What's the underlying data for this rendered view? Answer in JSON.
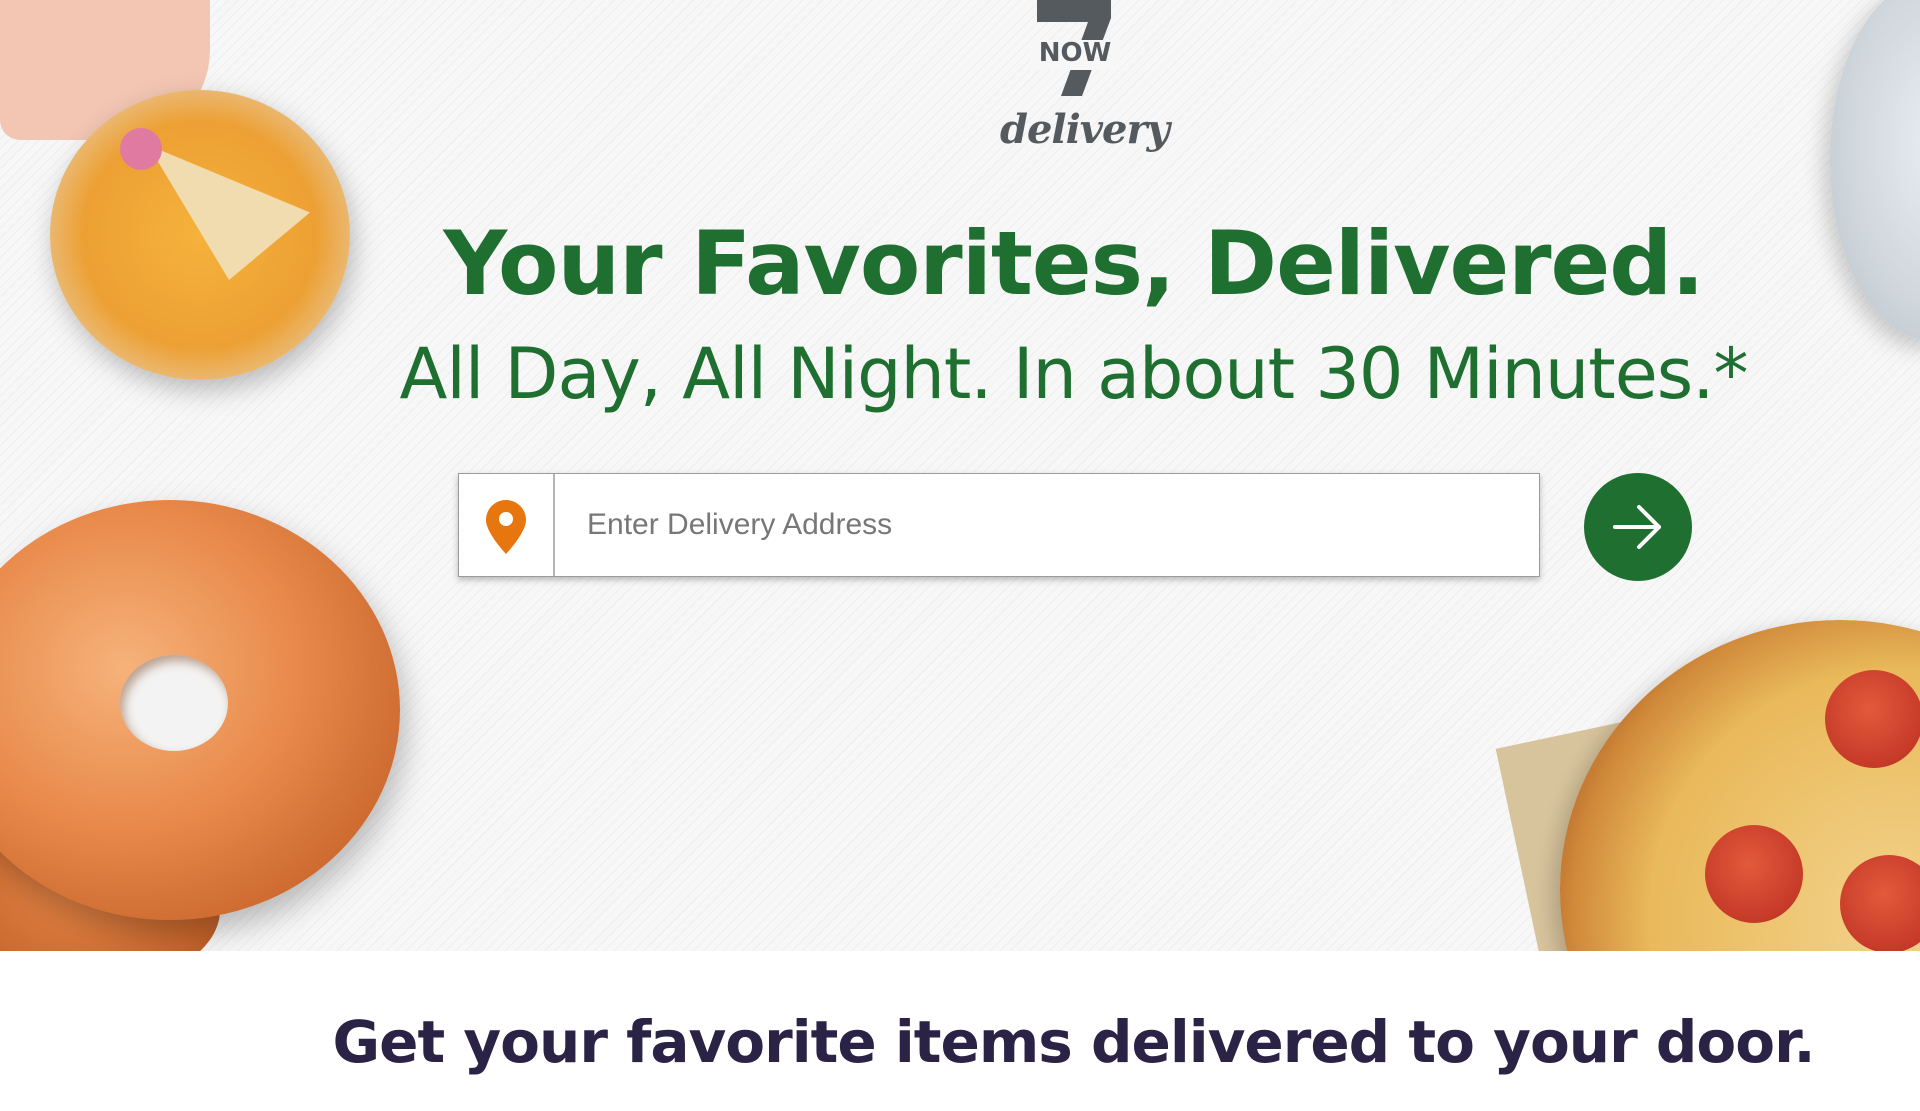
{
  "brand": {
    "logo_number": "7",
    "logo_now": "NOW",
    "logo_tagline": "delivery"
  },
  "hero": {
    "headline": "Your Favorites, Delivered.",
    "subheadline": "All Day, All Night. In about 30 Minutes.*"
  },
  "address": {
    "placeholder": "Enter Delivery Address",
    "pin_icon": "location-pin-icon",
    "submit_icon": "arrow-right-icon"
  },
  "section": {
    "heading": "Get your favorite items delivered to your door."
  },
  "colors": {
    "brand_green": "#1e6f30",
    "pin_orange": "#e8760f",
    "logo_gray": "#555a5f",
    "heading_purple": "#2a2346"
  }
}
